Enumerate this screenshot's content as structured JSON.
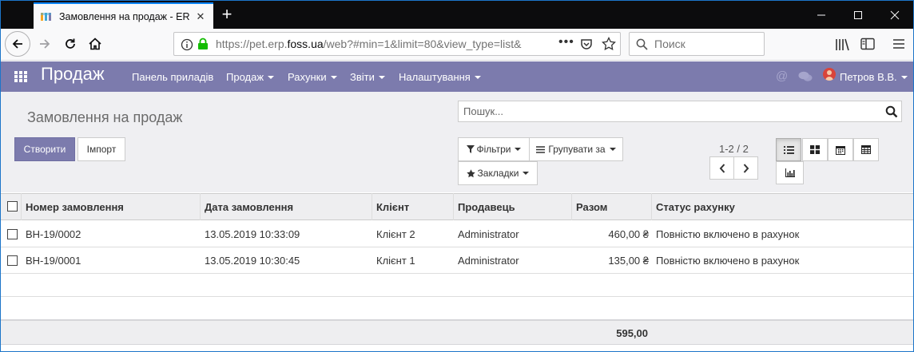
{
  "browser": {
    "tab_title": "Замовлення на продаж - ERP",
    "url_host_prefix": "https://pet.erp.",
    "url_host_main": "foss.ua",
    "url_path": "/web?#min=1&limit=80&view_type=list&",
    "search_placeholder": "Поиск",
    "icons": [
      "back-arrow-icon",
      "forward-arrow-icon",
      "reload-icon",
      "home-icon",
      "info-icon",
      "lock-icon",
      "more-icon",
      "pocket-icon",
      "star-icon",
      "library-icon",
      "sidebar-icon",
      "menu-icon"
    ],
    "accent": "#0a84ff"
  },
  "app": {
    "brand": "Продаж",
    "menus": [
      "Панель приладів",
      "Продаж",
      "Рахунки",
      "Звіти",
      "Налаштування"
    ],
    "user": "Петров В.В.",
    "bar_color": "#7c7bad"
  },
  "control": {
    "page_title": "Замовлення на продаж",
    "search_placeholder": "Пошук...",
    "create_label": "Створити",
    "import_label": "Імпорт",
    "filters_label": "Фільтри",
    "groupby_label": "Групувати за",
    "favorites_label": "Закладки",
    "pager": "1-2 / 2"
  },
  "table": {
    "columns": [
      "Номер замовлення",
      "Дата замовлення",
      "Клієнт",
      "Продавець",
      "Разом",
      "Статус рахунку"
    ],
    "rows": [
      {
        "number": "ВН-19/0002",
        "date": "13.05.2019 10:33:09",
        "client": "Клієнт 2",
        "seller": "Administrator",
        "total": "460,00 ₴",
        "status": "Повністю включено в рахунок"
      },
      {
        "number": "ВН-19/0001",
        "date": "13.05.2019 10:30:45",
        "client": "Клієнт 1",
        "seller": "Administrator",
        "total": "135,00 ₴",
        "status": "Повністю включено в рахунок"
      }
    ],
    "sum_total": "595,00"
  }
}
